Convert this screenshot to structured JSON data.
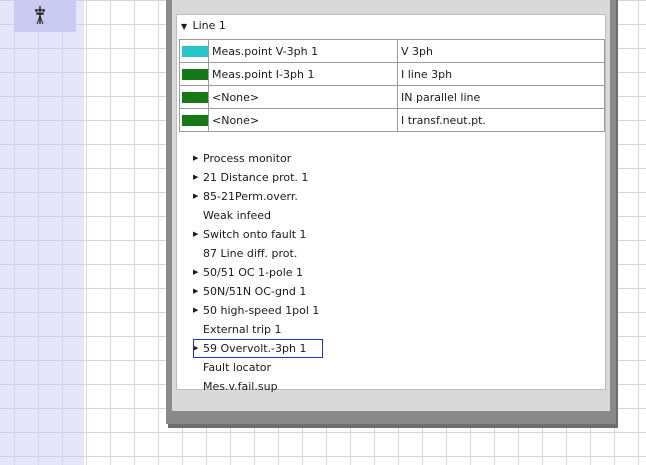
{
  "line": {
    "title": "Line 1"
  },
  "colors": {
    "cyan": "#26c6cf",
    "green": "#157a15"
  },
  "measurement_points": [
    {
      "swatch_color": "#26c6cf",
      "name": "Meas.point V-3ph 1",
      "type": "V 3ph"
    },
    {
      "swatch_color": "#157a15",
      "name": "Meas.point I-3ph 1",
      "type": "I line 3ph"
    },
    {
      "swatch_color": "#157a15",
      "name": "<None>",
      "type": "IN parallel line"
    },
    {
      "swatch_color": "#157a15",
      "name": "<None>",
      "type": "I transf.neut.pt."
    }
  ],
  "functions": [
    {
      "label": "Process monitor",
      "expandable": true
    },
    {
      "label": "21 Distance prot. 1",
      "expandable": true
    },
    {
      "label": "85-21Perm.overr.",
      "expandable": true
    },
    {
      "label": "Weak infeed",
      "expandable": false
    },
    {
      "label": "Switch onto fault 1",
      "expandable": true
    },
    {
      "label": "87 Line diff. prot.",
      "expandable": false
    },
    {
      "label": "50/51 OC 1-pole 1",
      "expandable": true
    },
    {
      "label": "50N/51N OC-gnd 1",
      "expandable": true
    },
    {
      "label": "50 high-speed 1pol 1",
      "expandable": true
    },
    {
      "label": "External trip 1",
      "expandable": false
    },
    {
      "label": "59 Overvolt.-3ph 1",
      "expandable": true,
      "selected": true
    },
    {
      "label": "Fault locator",
      "expandable": false
    },
    {
      "label": "Mes.v.fail.sup",
      "expandable": false
    }
  ],
  "icons": {
    "tower": "transmission-tower-icon",
    "expand": "triangle-right-icon",
    "collapse": "triangle-down-icon"
  }
}
